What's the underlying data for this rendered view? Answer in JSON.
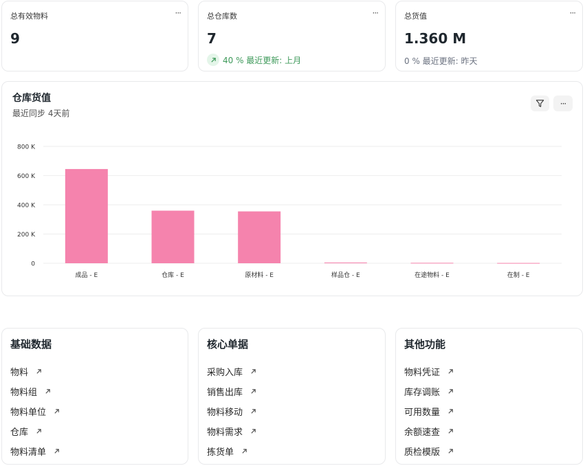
{
  "stats": [
    {
      "title": "总有效物料",
      "value": "9",
      "sub": "",
      "trend": ""
    },
    {
      "title": "总仓库数",
      "value": "7",
      "sub": "40 % 最近更新: 上月",
      "trend": "up"
    },
    {
      "title": "总货值",
      "value": "1.360 M",
      "sub": "0 % 最近更新: 昨天",
      "trend": "none"
    }
  ],
  "more_label": "···",
  "chart": {
    "title": "仓库货值",
    "subtitle": "最近同步 4天前"
  },
  "chart_data": {
    "type": "bar",
    "title": "仓库货值",
    "categories": [
      "成品 - E",
      "仓库 - E",
      "原材料 - E",
      "样品仓 - E",
      "在途物料 - E",
      "在制 - E"
    ],
    "values": [
      645000,
      360000,
      355000,
      5000,
      3000,
      2000
    ],
    "ylim": [
      0,
      800000
    ],
    "yticks": [
      0,
      200000,
      400000,
      600000,
      800000
    ],
    "ytick_labels": [
      "0",
      "200 K",
      "400 K",
      "600 K",
      "800 K"
    ],
    "bar_color": "#f583ad",
    "grid": true,
    "legend": "none"
  },
  "links": [
    {
      "title": "基础数据",
      "items": [
        "物料",
        "物料组",
        "物料单位",
        "仓库",
        "物料清单"
      ]
    },
    {
      "title": "核心单据",
      "items": [
        "采购入库",
        "销售出库",
        "物料移动",
        "物料需求",
        "拣货单"
      ]
    },
    {
      "title": "其他功能",
      "items": [
        "物料凭证",
        "库存调账",
        "可用数量",
        "余额速查",
        "质检模版"
      ]
    }
  ],
  "colors": {
    "accent_pink": "#f583ad",
    "trend_green": "#3f9a5b",
    "border": "#e8e9eb"
  }
}
